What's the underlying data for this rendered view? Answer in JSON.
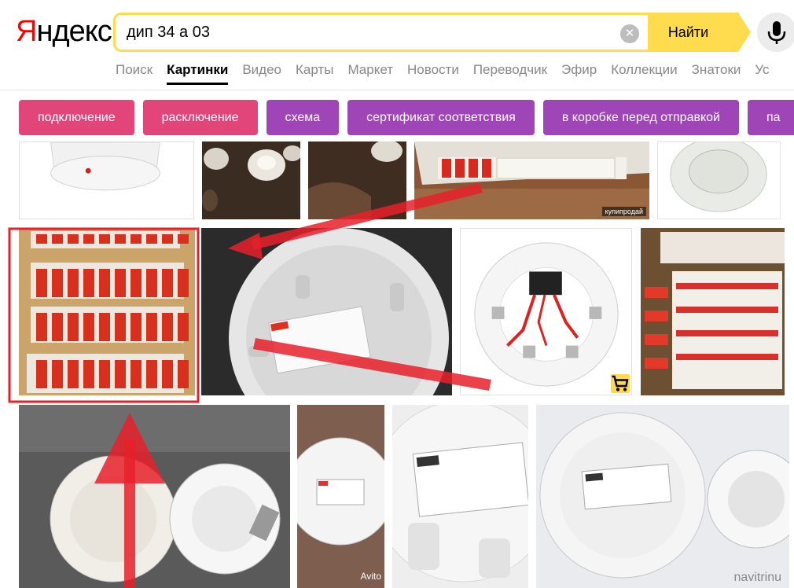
{
  "header": {
    "logo_first": "Я",
    "logo_rest": "ндекс",
    "search_value": "дип 34 а 03",
    "find_label": "Найти"
  },
  "nav": {
    "items": [
      {
        "label": "Поиск",
        "active": false
      },
      {
        "label": "Картинки",
        "active": true
      },
      {
        "label": "Видео",
        "active": false
      },
      {
        "label": "Карты",
        "active": false
      },
      {
        "label": "Маркет",
        "active": false
      },
      {
        "label": "Новости",
        "active": false
      },
      {
        "label": "Переводчик",
        "active": false
      },
      {
        "label": "Эфир",
        "active": false
      },
      {
        "label": "Коллекции",
        "active": false
      },
      {
        "label": "Знатоки",
        "active": false
      },
      {
        "label": "Ус",
        "active": false
      }
    ]
  },
  "chips": [
    {
      "label": "подключение",
      "color": "#e2457a"
    },
    {
      "label": "расключение",
      "color": "#e2457a"
    },
    {
      "label": "схема",
      "color": "#a045b8"
    },
    {
      "label": "сертификат соответствия",
      "color": "#a045b8"
    },
    {
      "label": "в коробке перед отправкой",
      "color": "#a045b8"
    },
    {
      "label": "па",
      "color": "#a045b8"
    }
  ],
  "image_labels": {
    "kupiprodai": "купипродай",
    "avito": "Avito",
    "navitrin": "navitrinu"
  },
  "colors": {
    "accent_yellow": "#ffdb4d",
    "annotation_red": "#e8202a",
    "logo_red": "#ff0000"
  }
}
